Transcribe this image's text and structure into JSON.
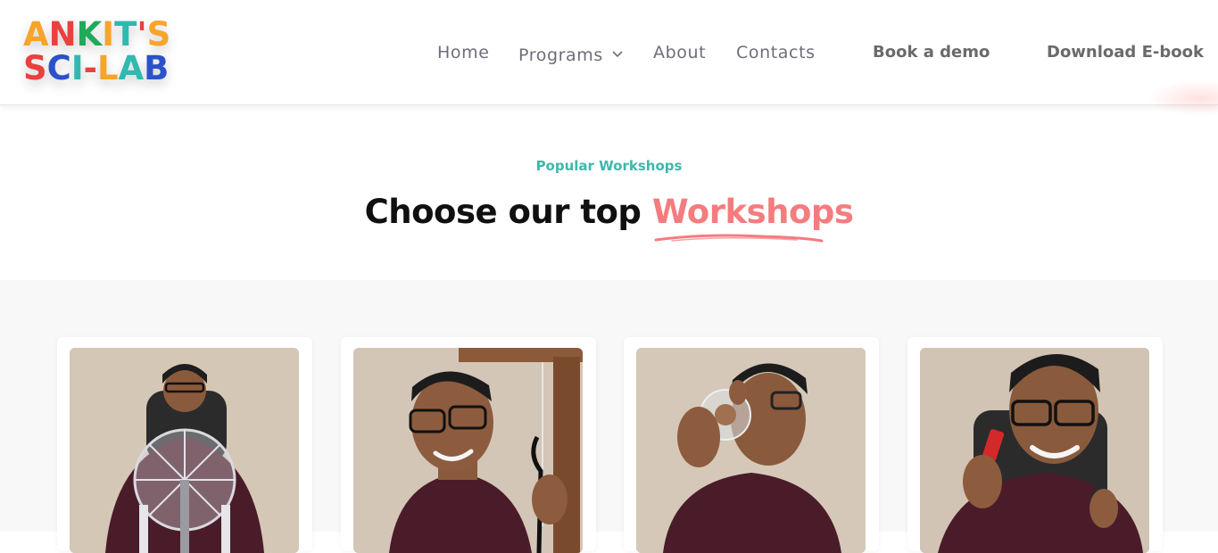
{
  "logo": {
    "line1": [
      "A",
      "N",
      "K",
      "I",
      "T",
      "'",
      "S"
    ],
    "line2": [
      "S",
      "C",
      "I",
      "-",
      "L",
      "A",
      "B"
    ],
    "colors1": [
      "#f7a42b",
      "#e8413f",
      "#1faa5b",
      "#f7a42b",
      "#2fb9b0",
      "#e8413f",
      "#f7a42b"
    ],
    "colors2": [
      "#e8413f",
      "#2a52c9",
      "#2fb9b0",
      "#e8413f",
      "#f7a42b",
      "#2fb9b0",
      "#2a52c9"
    ]
  },
  "nav": {
    "home": "Home",
    "programs": "Programs",
    "about": "About",
    "contacts": "Contacts",
    "book_demo": "Book a demo",
    "download": "Download E-book"
  },
  "section": {
    "eyebrow": "Popular Workshops",
    "title_main": "Choose our top ",
    "title_accent": "Workshops"
  },
  "colors": {
    "accent": "#f47c7f",
    "teal": "#3db8ad",
    "nav_text": "#6f6d79"
  },
  "cards": [
    {
      "image": "workshop-photo-wheel"
    },
    {
      "image": "workshop-photo-harp"
    },
    {
      "image": "workshop-photo-glass-sphere"
    },
    {
      "image": "workshop-photo-red-object"
    }
  ]
}
